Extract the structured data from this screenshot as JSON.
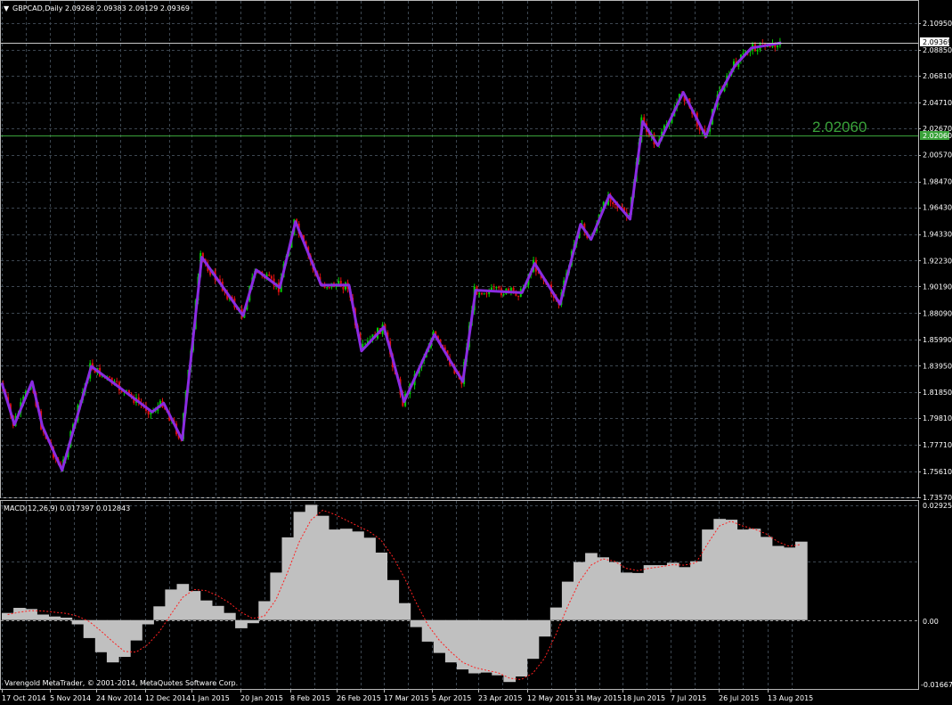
{
  "header": {
    "symbol_text": "GBPCAD,Daily  2.09268 2.09383 2.09129 2.09369",
    "dropdown_glyph": "▼"
  },
  "price_axis": {
    "ticks": [
      "2.10950",
      "2.08850",
      "2.06810",
      "2.04710",
      "2.02670",
      "2.00570",
      "1.98470",
      "1.96430",
      "1.94330",
      "1.92230",
      "1.90190",
      "1.88090",
      "1.85990",
      "1.83950",
      "1.81850",
      "1.79810",
      "1.77710",
      "1.75610",
      "1.73570"
    ],
    "current_price": "2.09369",
    "level_price_tag": "2.02060"
  },
  "level_line": {
    "label": "2.02060",
    "color": "#3aa33a"
  },
  "macd": {
    "title": "MACD(12,26,9) 0.017397 0.012843",
    "axis_top": "0.029253",
    "axis_zero": "0.00",
    "axis_bottom": "-0.016675"
  },
  "date_axis": [
    "17 Oct 2014",
    "5 Nov 2014",
    "24 Nov 2014",
    "12 Dec 2014",
    "1 Jan 2015",
    "20 Jan 2015",
    "8 Feb 2015",
    "26 Feb 2015",
    "17 Mar 2015",
    "5 Apr 2015",
    "23 Apr 2015",
    "12 May 2015",
    "31 May 2015",
    "18 Jun 2015",
    "7 Jul 2015",
    "26 Jul 2015",
    "13 Aug 2015"
  ],
  "copyright": "Varengold MetaTrader, © 2001-2014, MetaQuotes Software Corp.",
  "colors": {
    "bull_candle": "#00d000",
    "bear_candle": "#e01010",
    "zigzag": "#8a2be2",
    "macd_hist": "#c0c0c0",
    "macd_signal": "#ff2020",
    "grid": "#3c4650"
  },
  "chart_data": [
    {
      "type": "line",
      "title": "GBPCAD,Daily",
      "series": [
        {
          "name": "",
          "x": [
            "17 Oct 2014",
            "22 Oct 2014",
            "29 Oct 2014",
            "2 Nov 2014",
            "10 Nov 2014",
            "22 Nov 2014",
            "15 Dec 2014",
            "20 Dec 2014",
            "28 Dec 2014",
            "5 Jan 2015",
            "21 Jan 2015",
            "26 Jan 2015",
            "4 Feb 2015",
            "10 Feb 2015",
            "20 Feb 2015",
            "3 Mar 2015",
            "8 Mar 2015",
            "17 Mar 2015",
            "20 Mar 2015",
            "25 Mar 2015",
            "6 Apr 2015",
            "17 Apr 2015",
            "22 Apr 2015",
            "10 May 2015",
            "15 May 2015",
            "25 May 2015",
            "2 Jun 2015",
            "6 Jun 2015",
            "13 Jun 2015",
            "21 Jun 2015",
            "26 Jun 2015",
            "2 Jul 2015",
            "12 Jul 2015",
            "21 Jul 2015",
            "26 Jul 2015",
            "1 Aug 2015",
            "7 Aug 2015",
            "18 Aug 2015"
          ],
          "y": [
            1.826,
            1.793,
            1.827,
            1.792,
            1.757,
            1.839,
            1.803,
            1.81,
            1.781,
            1.925,
            1.879,
            1.915,
            1.901,
            1.953,
            1.903,
            1.903,
            1.851,
            1.87,
            1.849,
            1.811,
            1.864,
            1.827,
            1.899,
            1.897,
            1.92,
            1.888,
            1.951,
            1.939,
            1.974,
            1.955,
            2.032,
            2.013,
            2.055,
            2.02,
            2.052,
            2.076,
            2.09,
            2.094
          ]
        }
      ],
      "ylim": [
        1.7357,
        2.1095
      ],
      "grid": true
    },
    {
      "type": "bar",
      "title": "MACD(12,26,9) 0.017397 0.012843",
      "series": [
        {
          "name": "",
          "values": [
            0.0018,
            0.0031,
            0.0028,
            0.0014,
            0.0009,
            0.0006,
            -0.0011,
            -0.0046,
            -0.0082,
            -0.0108,
            -0.0094,
            -0.0052,
            -0.0011,
            0.0035,
            0.0078,
            0.0092,
            0.0074,
            0.005,
            0.0036,
            0.0018,
            -0.0021,
            -0.0008,
            0.0048,
            0.0121,
            0.0211,
            0.0276,
            0.0294,
            0.0266,
            0.0231,
            0.0233,
            0.0226,
            0.021,
            0.0172,
            0.0102,
            0.0043,
            -0.0018,
            -0.0055,
            -0.0084,
            -0.0108,
            -0.0126,
            -0.0136,
            -0.0134,
            -0.0141,
            -0.0158,
            -0.0144,
            -0.0099,
            -0.0042,
            0.0032,
            0.0098,
            0.0148,
            0.0171,
            0.016,
            0.0148,
            0.0121,
            0.012,
            0.014,
            0.014,
            0.0146,
            0.0135,
            0.015,
            0.0231,
            0.0258,
            0.0256,
            0.0231,
            0.0233,
            0.0212,
            0.0189,
            0.0185,
            0.02
          ],
          "color": "#c0c0c0"
        },
        {
          "name": "",
          "values": [
            0.0014,
            0.002,
            0.0024,
            0.0023,
            0.002,
            0.0017,
            0.001,
            -0.0004,
            -0.0028,
            -0.0055,
            -0.008,
            -0.0082,
            -0.0063,
            -0.003,
            0.0015,
            0.0058,
            0.0078,
            0.0075,
            0.0062,
            0.0044,
            0.002,
            0.0004,
            0.001,
            0.0052,
            0.0122,
            0.02,
            0.0255,
            0.028,
            0.027,
            0.0255,
            0.024,
            0.0226,
            0.0204,
            0.0162,
            0.0108,
            0.0045,
            -0.0012,
            -0.0052,
            -0.0082,
            -0.0108,
            -0.0121,
            -0.0128,
            -0.0134,
            -0.0148,
            -0.0152,
            -0.0136,
            -0.0098,
            -0.0036,
            0.0035,
            0.0098,
            0.014,
            0.0156,
            0.015,
            0.0132,
            0.0126,
            0.0132,
            0.0136,
            0.0141,
            0.014,
            0.0146,
            0.0195,
            0.024,
            0.0252,
            0.024,
            0.0232,
            0.022,
            0.02,
            0.0188,
            0.0193
          ],
          "color": "#ff2020"
        }
      ],
      "ylim": [
        -0.016675,
        0.029253
      ],
      "grid": true
    }
  ]
}
